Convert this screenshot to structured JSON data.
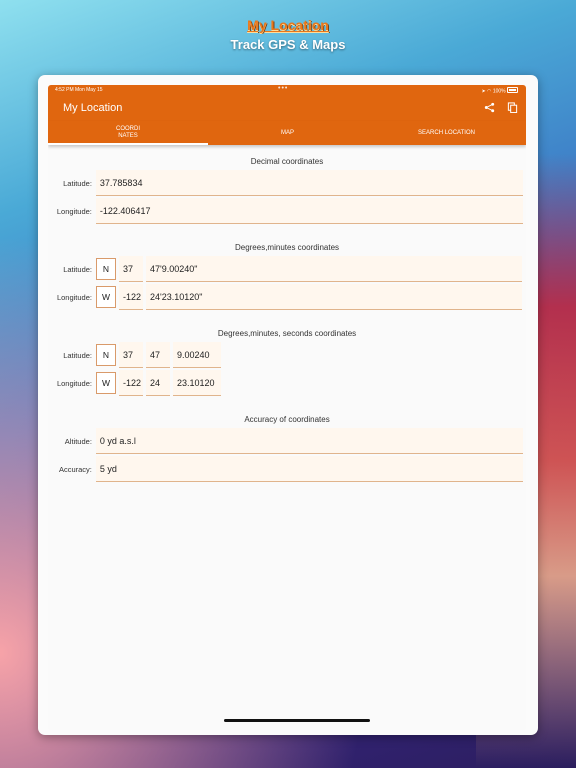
{
  "promo": {
    "title": "My Location",
    "subtitle": "Track GPS & Maps"
  },
  "statusbar": {
    "time": "4:52 PM  Mon May 15",
    "dots": "•••",
    "battery": "100%"
  },
  "app": {
    "title": "My Location"
  },
  "tabs": [
    {
      "label": "COORDI\nNATES",
      "active": true
    },
    {
      "label": "MAP",
      "active": false
    },
    {
      "label": "SEARCH LOCATION",
      "active": false
    }
  ],
  "decimal": {
    "title": "Decimal coordinates",
    "lat_label": "Latitude:",
    "lat": "37.785834",
    "lon_label": "Longitude:",
    "lon": "-122.406417"
  },
  "dm": {
    "title": "Degrees,minutes coordinates",
    "lat_label": "Latitude:",
    "lat_dir": "N",
    "lat_deg": "37",
    "lat_min": "47'9.00240\"",
    "lon_label": "Longitude:",
    "lon_dir": "W",
    "lon_deg": "-122",
    "lon_min": "24'23.10120\""
  },
  "dms": {
    "title": "Degrees,minutes, seconds coordinates",
    "lat_label": "Latitude:",
    "lat_dir": "N",
    "lat_deg": "37",
    "lat_min": "47",
    "lat_sec": "9.00240",
    "lon_label": "Longitude:",
    "lon_dir": "W",
    "lon_deg": "-122",
    "lon_min": "24",
    "lon_sec": "23.10120"
  },
  "accuracy": {
    "title": "Accuracy of coordinates",
    "alt_label": "Altitude:",
    "alt": "0 yd a.s.l",
    "acc_label": "Accuracy:",
    "acc": "5 yd"
  },
  "icons": {
    "share": "share-icon",
    "copy": "copy-icon",
    "location": "location-arrow-icon",
    "wifi": "wifi-icon",
    "battery": "battery-icon"
  },
  "colors": {
    "accent": "#e0660f",
    "field_bg": "#fff7ee",
    "field_border": "#e0b48c"
  }
}
